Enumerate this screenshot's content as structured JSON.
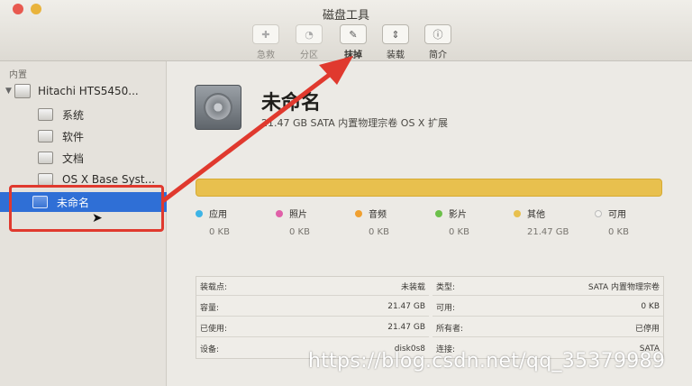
{
  "window": {
    "title": "磁盘工具"
  },
  "toolbar": [
    {
      "label": "急救",
      "icon": "stethoscope-icon",
      "glyph": "✚",
      "enabled": false
    },
    {
      "label": "分区",
      "icon": "partition-icon",
      "glyph": "◔",
      "enabled": false
    },
    {
      "label": "抹掉",
      "icon": "erase-icon",
      "glyph": "✎",
      "enabled": true
    },
    {
      "label": "装载",
      "icon": "mount-icon",
      "glyph": "⇕",
      "enabled": true
    },
    {
      "label": "简介",
      "icon": "info-icon",
      "glyph": "ⓘ",
      "enabled": true
    }
  ],
  "sidebar": {
    "section": "内置",
    "disk": "Hitachi HTS5450...",
    "volumes": [
      "系统",
      "软件",
      "文档",
      "OS X Base Syst..."
    ],
    "selected": "未命名"
  },
  "volume": {
    "name": "未命名",
    "description": "21.47 GB SATA 内置物理宗卷 OS X 扩展"
  },
  "usage": [
    {
      "name": "应用",
      "value": "0 KB",
      "color": "#3db4e6"
    },
    {
      "name": "照片",
      "value": "0 KB",
      "color": "#e060a8"
    },
    {
      "name": "音频",
      "value": "0 KB",
      "color": "#f0a030"
    },
    {
      "name": "影片",
      "value": "0 KB",
      "color": "#6cc04a"
    },
    {
      "name": "其他",
      "value": "21.47 GB",
      "color": "#e8c04e"
    },
    {
      "name": "可用",
      "value": "0 KB",
      "color": "#f4f3ef"
    }
  ],
  "info": {
    "left": [
      {
        "k": "装载点:",
        "v": "未装载"
      },
      {
        "k": "容量:",
        "v": "21.47 GB"
      },
      {
        "k": "已使用:",
        "v": "21.47 GB"
      },
      {
        "k": "设备:",
        "v": "disk0s8"
      }
    ],
    "right": [
      {
        "k": "类型:",
        "v": "SATA 内置物理宗卷"
      },
      {
        "k": "可用:",
        "v": "0 KB"
      },
      {
        "k": "所有者:",
        "v": "已停用"
      },
      {
        "k": "连接:",
        "v": "SATA"
      }
    ]
  },
  "watermark": "https://blog.csdn.net/qq_35379989",
  "annotation_color": "#e0392e"
}
